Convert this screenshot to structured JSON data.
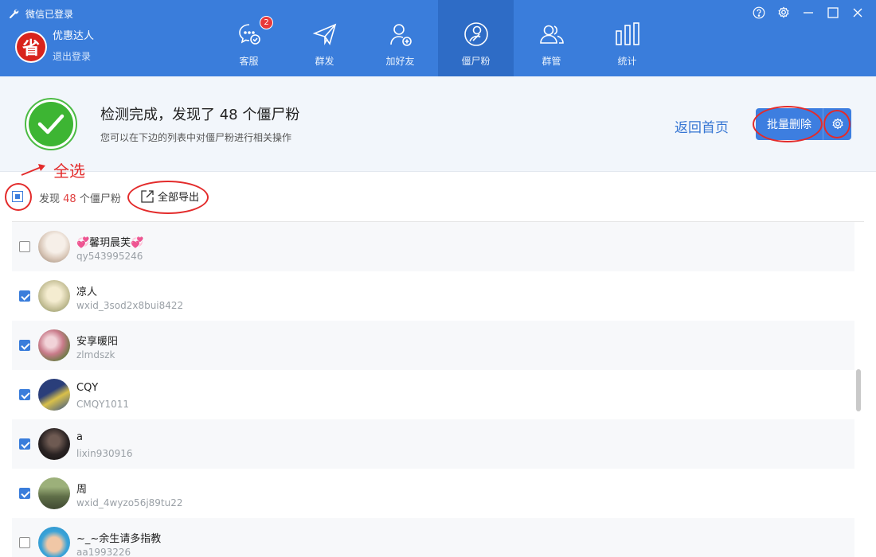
{
  "window": {
    "title": "微信已登录"
  },
  "user": {
    "logo_char": "省",
    "name": "优惠达人",
    "logout": "退出登录"
  },
  "nav": [
    {
      "label": "客服",
      "icon": "chat-icon",
      "badge": "2"
    },
    {
      "label": "群发",
      "icon": "send-icon"
    },
    {
      "label": "加好友",
      "icon": "add-friend-icon"
    },
    {
      "label": "僵尸粉",
      "icon": "zombie-fan-icon",
      "active": true
    },
    {
      "label": "群管",
      "icon": "group-manage-icon"
    },
    {
      "label": "统计",
      "icon": "stats-icon"
    }
  ],
  "result": {
    "title": "检测完成，发现了 48 个僵尸粉",
    "subtitle": "您可以在下边的列表中对僵尸粉进行相关操作",
    "back_home": "返回首页",
    "batch_delete": "批量删除"
  },
  "annotation": {
    "select_all": "全选"
  },
  "toolbar": {
    "found_prefix": "发现",
    "found_count": "48",
    "found_suffix": "个僵尸粉",
    "export_all": "全部导出"
  },
  "contacts": [
    {
      "name": "💞馨玥晨芙💞",
      "id": "qy543995246",
      "checked": false
    },
    {
      "name": "凉人",
      "id": "wxid_3sod2x8bui8422",
      "checked": true
    },
    {
      "name": "安享暖阳",
      "id": "zlmdszk",
      "checked": true
    },
    {
      "name": "CQY",
      "id": "CMQY1011",
      "checked": true
    },
    {
      "name": "a",
      "id": "lixin930916",
      "checked": true
    },
    {
      "name": "周",
      "id": "wxid_4wyzo56j89tu22",
      "checked": true
    },
    {
      "name": "~_~余生请多指教",
      "id": "aa1993226",
      "checked": false
    }
  ],
  "colors": {
    "header": "#3a7ddb",
    "accent": "#3d7ee0",
    "success": "#3db533",
    "annotation": "#e32b2b"
  }
}
